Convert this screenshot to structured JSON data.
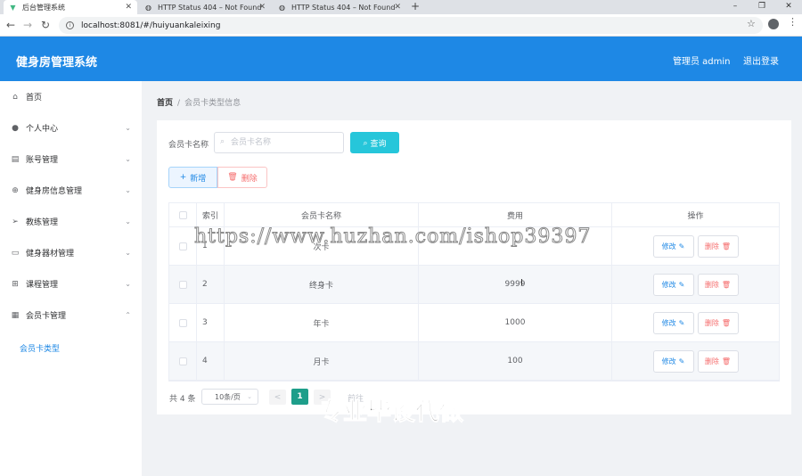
{
  "browser": {
    "tabs": [
      {
        "title": "后台管理系统",
        "active": true
      },
      {
        "title": "HTTP Status 404 – Not Found",
        "active": false
      },
      {
        "title": "HTTP Status 404 – Not Found",
        "active": false
      }
    ],
    "url": "localhost:8081/#/huiyuankaleixing",
    "new_tab": "+",
    "window_buttons": [
      "–",
      "❐",
      "✕"
    ]
  },
  "header": {
    "title": "健身房管理系统",
    "user": "管理员 admin",
    "logout": "退出登录",
    "color": "#1e88e5"
  },
  "sidebar": {
    "items": [
      {
        "label": "首页",
        "icon": "home-icon",
        "expandable": false
      },
      {
        "label": "个人中心",
        "icon": "user-icon",
        "expandable": true
      },
      {
        "label": "账号管理",
        "icon": "briefcase-icon",
        "expandable": true
      },
      {
        "label": "健身房信息管理",
        "icon": "compass-icon",
        "expandable": true
      },
      {
        "label": "教练管理",
        "icon": "send-icon",
        "expandable": true
      },
      {
        "label": "健身器材管理",
        "icon": "document-icon",
        "expandable": true
      },
      {
        "label": "课程管理",
        "icon": "grid-icon",
        "expandable": true
      },
      {
        "label": "会员卡管理",
        "icon": "apps-icon",
        "expandable": true,
        "expanded": true
      }
    ],
    "sub_item": "会员卡类型"
  },
  "breadcrumb": {
    "home": "首页",
    "separator": "/",
    "current": "会员卡类型信息"
  },
  "search": {
    "label": "会员卡名称",
    "placeholder": "会员卡名称",
    "value": "",
    "button": "查询"
  },
  "actions": {
    "add": "新增",
    "delete": "删除"
  },
  "table": {
    "columns": [
      "",
      "索引",
      "会员卡名称",
      "费用",
      "操作"
    ],
    "rows": [
      {
        "index": "1",
        "name": "次卡",
        "fee": "",
        "edit": "修改",
        "remove": "删除"
      },
      {
        "index": "2",
        "name": "终身卡",
        "fee": "9999",
        "edit": "修改",
        "remove": "删除"
      },
      {
        "index": "3",
        "name": "年卡",
        "fee": "1000",
        "edit": "修改",
        "remove": "删除"
      },
      {
        "index": "4",
        "name": "月卡",
        "fee": "100",
        "edit": "修改",
        "remove": "删除"
      }
    ]
  },
  "pagination": {
    "total": "共 4 条",
    "page_size": "10条/页",
    "current_page": "1",
    "prev": "<",
    "next": ">",
    "goto": "前往"
  },
  "watermarks": {
    "url": "https://www.huzhan.com/ishop39397",
    "text": "专业毕设代做"
  }
}
